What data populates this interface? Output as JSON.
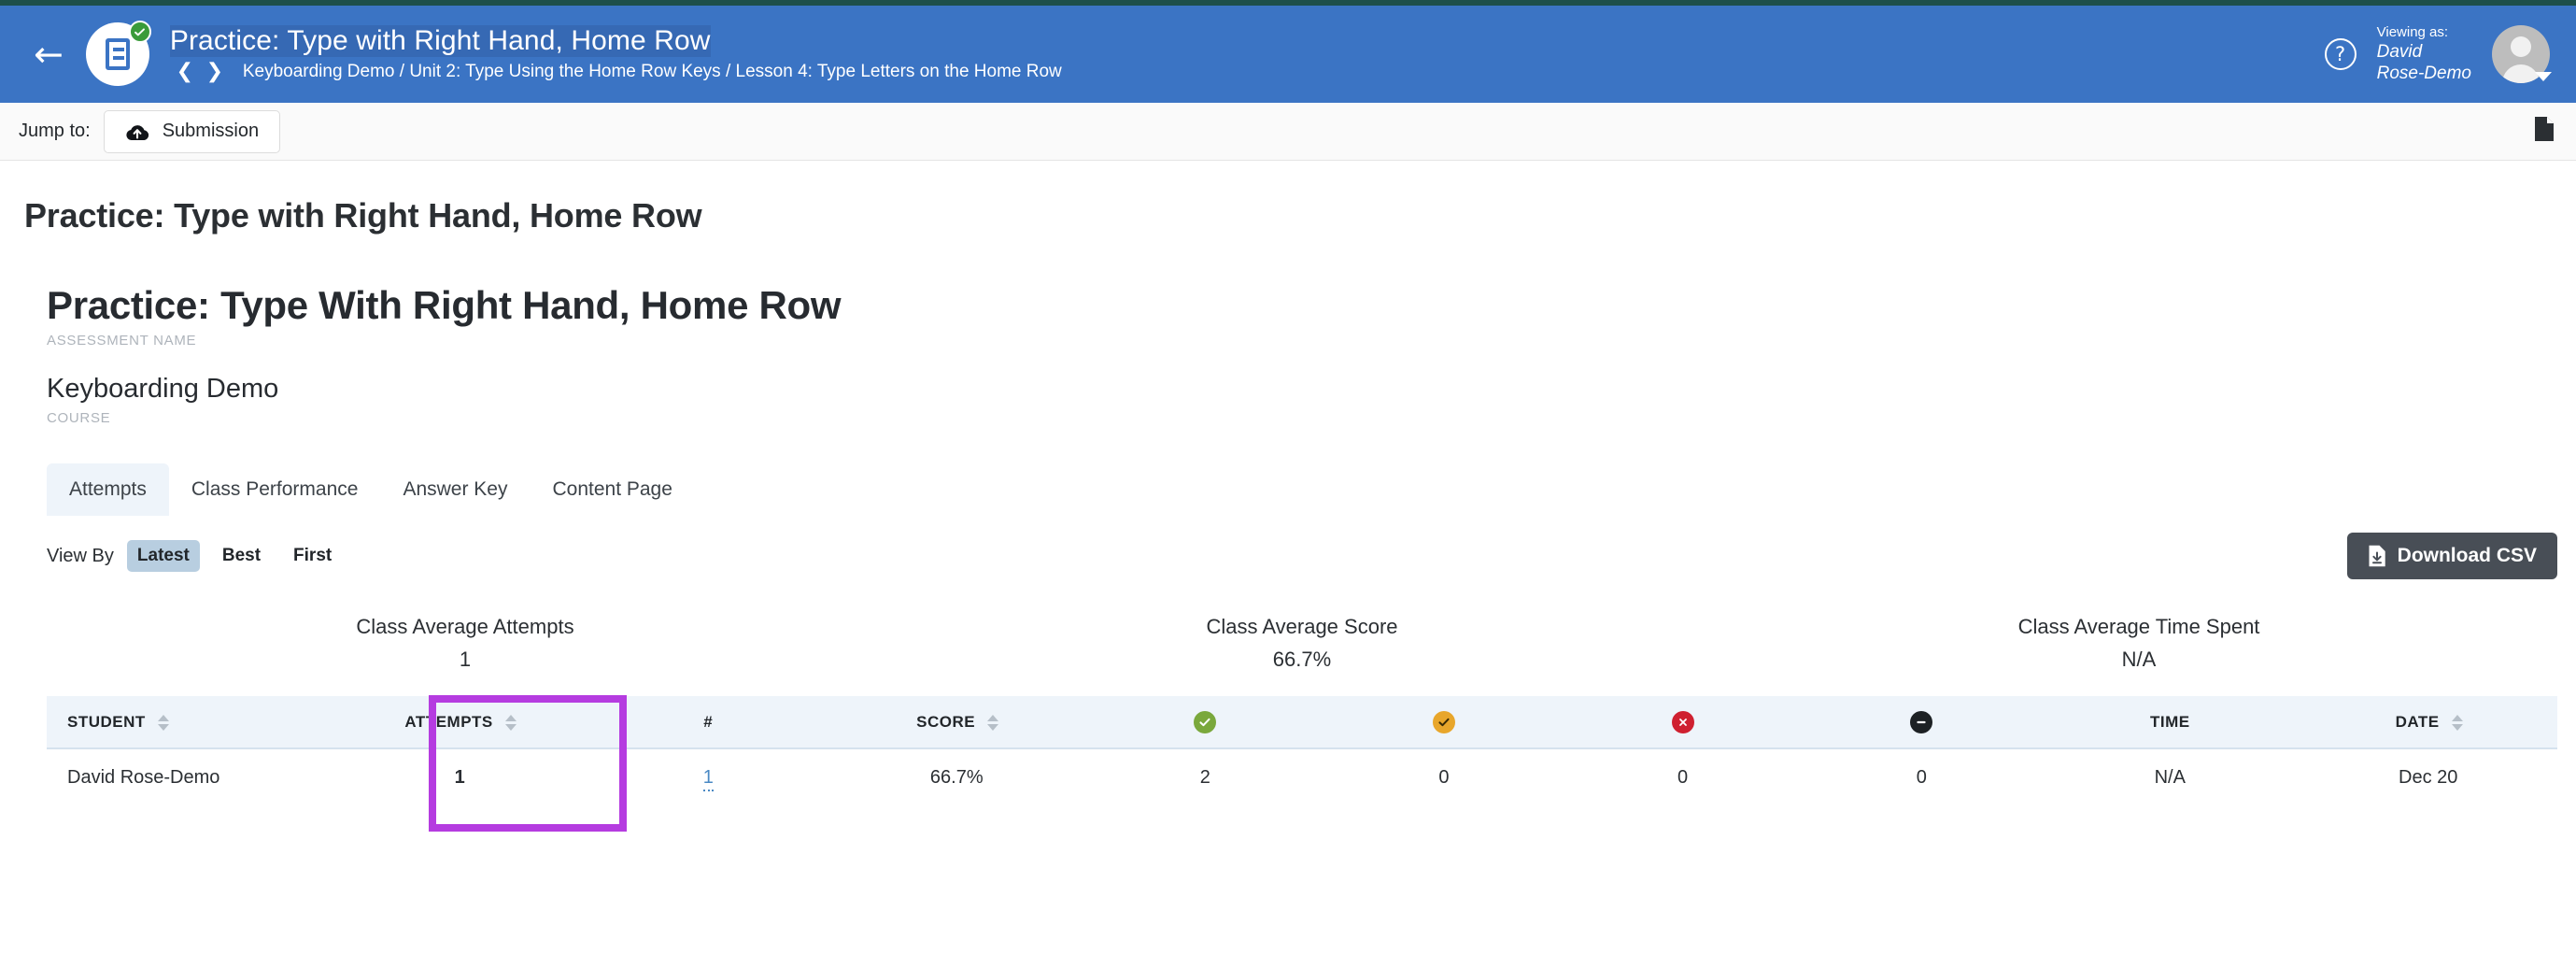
{
  "header": {
    "back_icon": "back-arrow-icon",
    "app_icon": "document-icon",
    "status_badge_icon": "check-circle-icon",
    "title": "Practice: Type with Right Hand, Home Row",
    "breadcrumb_prev_icon": "chevron-left-icon",
    "breadcrumb_next_icon": "chevron-right-icon",
    "breadcrumb": "Keyboarding Demo / Unit 2: Type Using the Home Row Keys / Lesson 4: Type Letters on the Home Row",
    "help_icon": "question-circle-icon",
    "viewing_as_label": "Viewing as:",
    "viewing_as_name_line1": "David",
    "viewing_as_name_line2": "Rose-Demo",
    "avatar_icon": "user-avatar-icon",
    "avatar_caret_icon": "caret-down-icon"
  },
  "jump_bar": {
    "label": "Jump to:",
    "submission_button": "Submission",
    "submission_icon": "cloud-upload-icon",
    "right_icon": "document-file-icon"
  },
  "page": {
    "title": "Practice: Type with Right Hand, Home Row",
    "assessment_name": "Practice: Type With Right Hand, Home Row",
    "assessment_caption": "ASSESSMENT NAME",
    "course_name": "Keyboarding Demo",
    "course_caption": "COURSE"
  },
  "tabs": [
    {
      "label": "Attempts",
      "active": true
    },
    {
      "label": "Class Performance",
      "active": false
    },
    {
      "label": "Answer Key",
      "active": false
    },
    {
      "label": "Content Page",
      "active": false
    }
  ],
  "view_by": {
    "label": "View By",
    "options": [
      {
        "label": "Latest",
        "active": true
      },
      {
        "label": "Best",
        "active": false
      },
      {
        "label": "First",
        "active": false
      }
    ],
    "download_button": "Download CSV",
    "download_icon": "file-download-icon"
  },
  "stats": [
    {
      "title": "Class Average Attempts",
      "value": "1"
    },
    {
      "title": "Class Average Score",
      "value": "66.7%"
    },
    {
      "title": "Class Average Time Spent",
      "value": "N/A"
    }
  ],
  "table": {
    "columns": [
      {
        "label": "STUDENT",
        "type": "text",
        "sortable": true,
        "align": "left"
      },
      {
        "label": "ATTEMPTS",
        "type": "text",
        "sortable": true,
        "align": "center"
      },
      {
        "label": "#",
        "type": "text",
        "sortable": false,
        "align": "center"
      },
      {
        "label": "SCORE",
        "type": "text",
        "sortable": true,
        "align": "center"
      },
      {
        "label": "",
        "type": "icon",
        "icon": "check-circle-green-icon",
        "sortable": false,
        "align": "center"
      },
      {
        "label": "",
        "type": "icon",
        "icon": "check-circle-yellow-icon",
        "sortable": false,
        "align": "center"
      },
      {
        "label": "",
        "type": "icon",
        "icon": "x-circle-red-icon",
        "sortable": false,
        "align": "center"
      },
      {
        "label": "",
        "type": "icon",
        "icon": "minus-circle-dark-icon",
        "sortable": false,
        "align": "center"
      },
      {
        "label": "TIME",
        "type": "text",
        "sortable": false,
        "align": "center"
      },
      {
        "label": "DATE",
        "type": "text",
        "sortable": true,
        "align": "center"
      }
    ],
    "rows": [
      {
        "student": "David Rose-Demo",
        "attempts": "1",
        "attempt_number": "1",
        "score": "66.7%",
        "correct": "2",
        "partial": "0",
        "incorrect": "0",
        "skipped": "0",
        "time": "N/A",
        "date": "Dec 20"
      }
    ]
  },
  "annotation": {
    "highlight_color": "#b53ce0",
    "highlight_target": "attempt-number-column"
  },
  "colors": {
    "header_blue": "#3b74c4",
    "accent_link": "#4a89c4",
    "table_header_bg": "#eef4fa",
    "download_btn": "#484e56",
    "pill_active": "#b8cee0"
  }
}
